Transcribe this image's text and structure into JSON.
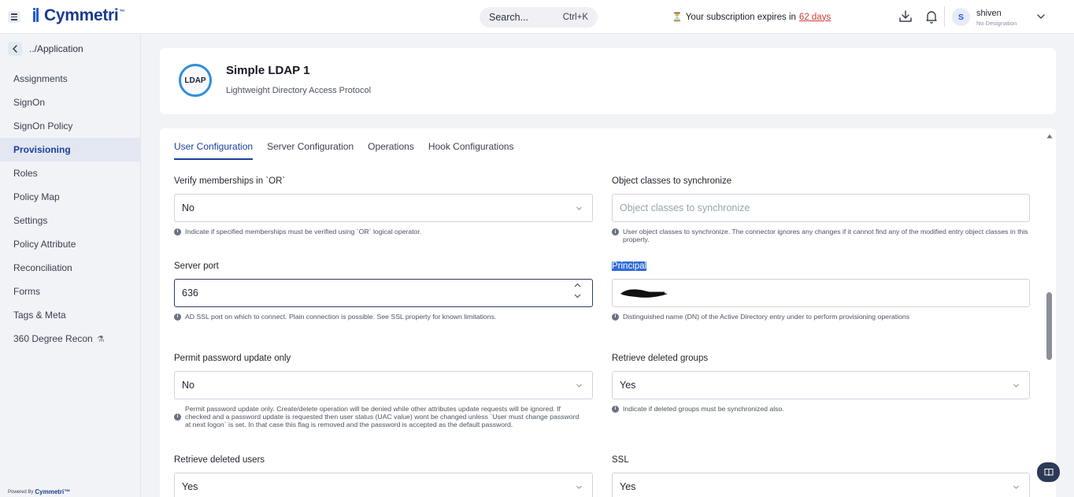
{
  "brand": {
    "name": "Cymmetri",
    "tm": "™"
  },
  "search": {
    "placeholder": "Search...",
    "shortcut": "Ctrl+K"
  },
  "subscription": {
    "prefix": "Your subscription expires in",
    "days": "62 days"
  },
  "user": {
    "initial": "S",
    "name": "shiven",
    "designation": "No Designation"
  },
  "sidebar": {
    "back_label": "../Application",
    "items": [
      {
        "label": "Assignments",
        "active": false
      },
      {
        "label": "SignOn",
        "active": false
      },
      {
        "label": "SignOn Policy",
        "active": false
      },
      {
        "label": "Provisioning",
        "active": true
      },
      {
        "label": "Roles",
        "active": false
      },
      {
        "label": "Policy Map",
        "active": false
      },
      {
        "label": "Settings",
        "active": false
      },
      {
        "label": "Policy Attribute",
        "active": false
      },
      {
        "label": "Reconciliation",
        "active": false
      },
      {
        "label": "Forms",
        "active": false
      },
      {
        "label": "Tags & Meta",
        "active": false
      },
      {
        "label": "360 Degree Recon",
        "active": false
      }
    ],
    "powered_by": "Powered By",
    "powered_brand": "Cymmetri™"
  },
  "app": {
    "badge": "LDAP",
    "title": "Simple LDAP 1",
    "subtitle": "Lightweight Directory Access Protocol"
  },
  "tabs": [
    {
      "label": "User Configuration",
      "active": true
    },
    {
      "label": "Server Configuration",
      "active": false
    },
    {
      "label": "Operations",
      "active": false
    },
    {
      "label": "Hook Configurations",
      "active": false
    }
  ],
  "fields": {
    "verify_memberships": {
      "label": "Verify memberships in `OR`",
      "value": "No",
      "help": "Indicate if specified memberships must be verified using `OR` logical operator."
    },
    "object_classes": {
      "label": "Object classes to synchronize",
      "placeholder": "Object classes to synchronize",
      "help": "User object classes to synchronize. The connector ignores any changes if it cannot find any of the modified entry object classes in this property."
    },
    "server_port": {
      "label": "Server port",
      "value": "636",
      "help": "AD SSL port on which to connect. Plain connection is possible. See SSL property for known limitations."
    },
    "principal": {
      "label": "Principal",
      "help": "Distinguished name (DN) of the Active Directory entry under to perform provisioning operations"
    },
    "permit_password": {
      "label": "Permit password update only",
      "value": "No",
      "help": "Permit password update only. Create/delete operation will be denied while other attributes update requests will be ignored. If checked and a password update is requested then user status (UAC value) wont be changed unless `User must change password at next logon` is set. In that case this flag is removed and the password is accepted as the default password."
    },
    "retrieve_groups": {
      "label": "Retrieve deleted groups",
      "value": "Yes",
      "help": "Indicate if deleted groups must be synchronized also."
    },
    "retrieve_users": {
      "label": "Retrieve deleted users",
      "value": "Yes"
    },
    "ssl": {
      "label": "SSL",
      "value": "Yes"
    }
  },
  "colors": {
    "accent": "#1a3f9e",
    "brand": "#1d5bd8",
    "warning": "#d13b3b"
  }
}
